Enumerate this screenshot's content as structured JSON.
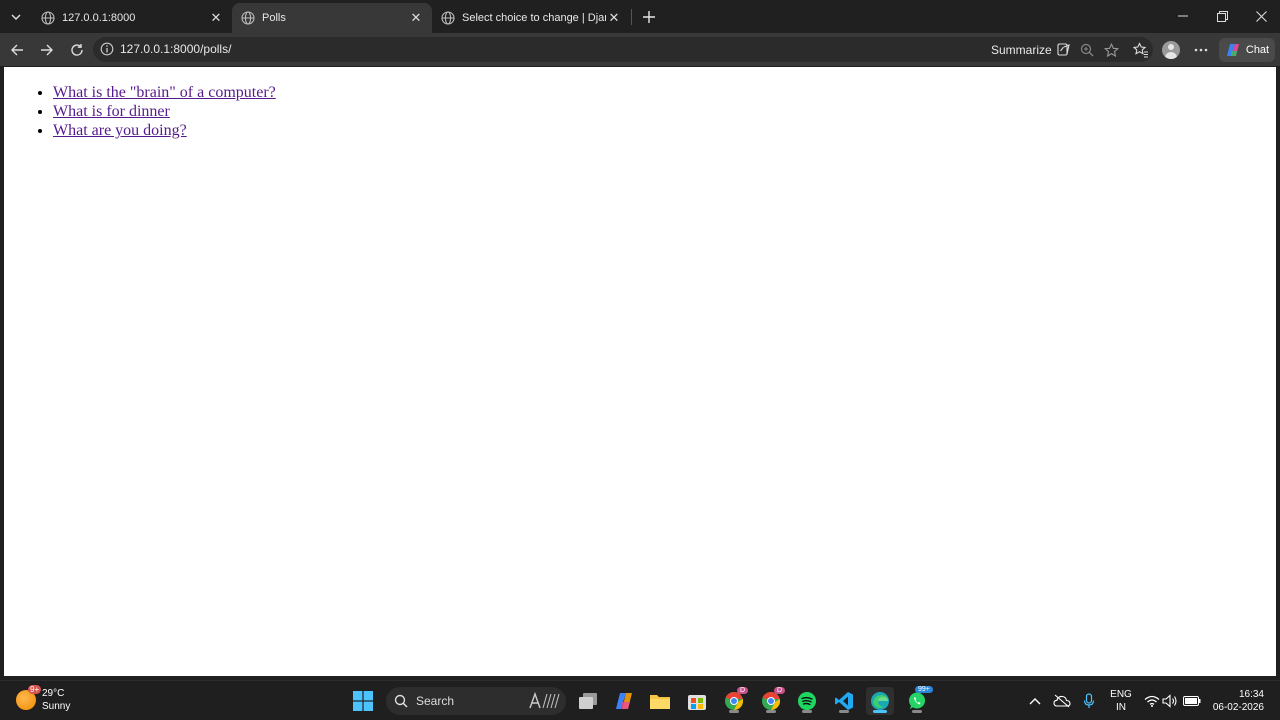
{
  "browser": {
    "tabs": [
      {
        "title": "127.0.0.1:8000",
        "active": false,
        "icon": "globe-icon"
      },
      {
        "title": "Polls",
        "active": true,
        "icon": "globe-icon"
      },
      {
        "title": "Select choice to change | Django s",
        "active": false,
        "icon": "globe-icon"
      }
    ],
    "address": "127.0.0.1:8000/polls/",
    "summarize_label": "Summarize",
    "chat_label": "Chat"
  },
  "page": {
    "questions": [
      "What is the \"brain\" of a computer?",
      "What is for dinner",
      "What are you doing?"
    ],
    "link_color": "#551a8b"
  },
  "taskbar": {
    "weather": {
      "temp": "29°C",
      "condition": "Sunny",
      "badge": "9+"
    },
    "search_label": "Search",
    "chrome_badge": "D",
    "chrome2_badge": "D",
    "whatsapp_badge": "99+",
    "lang_top": "ENG",
    "lang_bottom": "IN",
    "time": "16:34",
    "date": "06-02-2026"
  },
  "colors": {
    "accent": "#4cc2ff",
    "frame": "#202020",
    "toolbar": "#383838"
  }
}
